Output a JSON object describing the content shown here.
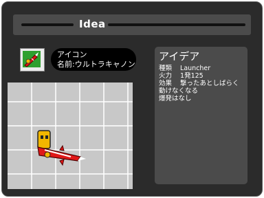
{
  "dialog": {
    "title": "Idea"
  },
  "icon_card": {
    "label": "アイコン",
    "name_line": "名前:ウルトラキャノン"
  },
  "info": {
    "title": "アイデア",
    "rows": [
      {
        "key": "種類",
        "value": "Launcher"
      },
      {
        "key": "火力",
        "value": "1発125"
      },
      {
        "key": "効果",
        "value": "撃ったあとしばらく"
      }
    ],
    "extra_lines": [
      "動けなくなる",
      "爆発はなし"
    ]
  },
  "colors": {
    "panel_bg": "#2b2b2b",
    "info_bg": "#4b4b4b",
    "grid_bg": "#c8c8c8",
    "weapon_red": "#e01818",
    "char_yellow": "#f2b600",
    "icon_green": "#2fa02f"
  }
}
